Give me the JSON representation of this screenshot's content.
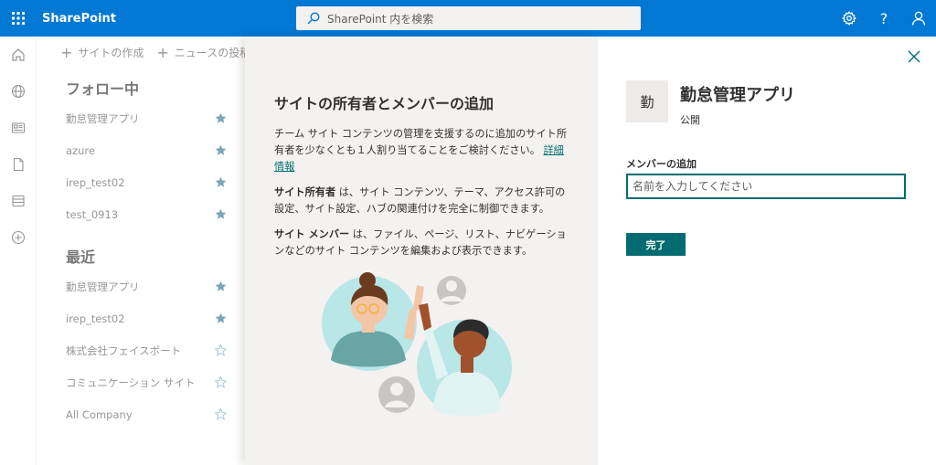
{
  "topbar": {
    "brand": "SharePoint",
    "search_placeholder": "SharePoint 内を検索",
    "colors": {
      "bar": "#0078d4"
    }
  },
  "commands": {
    "create_site": "サイトの作成",
    "create_news": "ニュースの投稿"
  },
  "following": {
    "title": "フォロー中",
    "items": [
      {
        "label": "勤怠管理アプリ",
        "starred": true
      },
      {
        "label": "azure",
        "starred": true
      },
      {
        "label": "irep_test02",
        "starred": true
      },
      {
        "label": "test_0913",
        "starred": true
      }
    ]
  },
  "recent": {
    "title": "最近",
    "items": [
      {
        "label": "勤怠管理アプリ",
        "starred": true
      },
      {
        "label": "irep_test02",
        "starred": true
      },
      {
        "label": "株式会社フェイスポート",
        "starred": false
      },
      {
        "label": "コミュニケーション サイト",
        "starred": false
      },
      {
        "label": "All Company",
        "starred": false
      }
    ]
  },
  "info": {
    "title": "サイトの所有者とメンバーの追加",
    "p1": "チーム サイト コンテンツの管理を支援するのに追加のサイト所有者を少なくとも１人割り当てることをご検討ください。",
    "p1_link": "詳細情報",
    "owner_term": "サイト所有者",
    "owner_text": " は、サイト コンテンツ、テーマ、アクセス許可の設定、サイト設定、ハブの関連付けを完全に制御できます。",
    "member_term": "サイト メンバー",
    "member_text": " は、ファイル、ページ、リスト、ナビゲーションなどのサイト コンテンツを編集および表示できます。"
  },
  "site": {
    "logo_char": "勤",
    "name": "勤怠管理アプリ",
    "privacy": "公開",
    "add_members_label": "メンバーの追加",
    "input_placeholder": "名前を入力してください",
    "done_label": "完了",
    "accent": "#036c70"
  }
}
